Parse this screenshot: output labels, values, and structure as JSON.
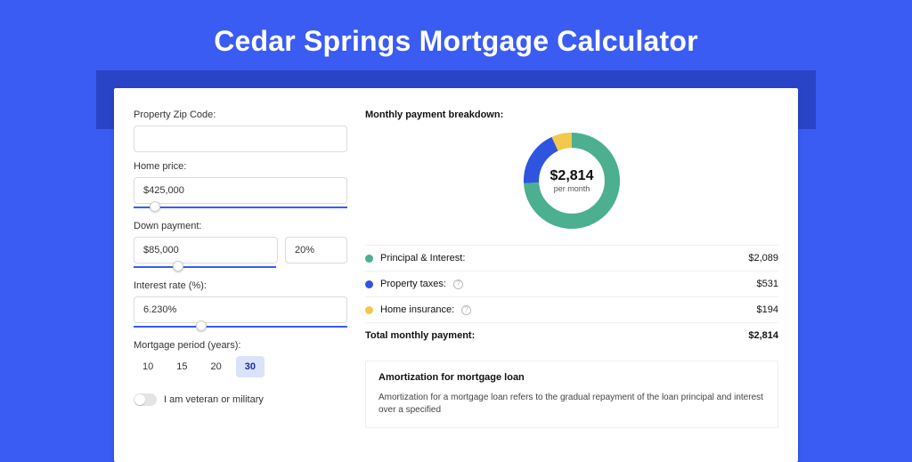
{
  "title": "Cedar Springs Mortgage Calculator",
  "form": {
    "zip_label": "Property Zip Code:",
    "zip_value": "",
    "home_price_label": "Home price:",
    "home_price_value": "$425,000",
    "down_payment_label": "Down payment:",
    "down_payment_amount": "$85,000",
    "down_payment_pct": "20%",
    "interest_label": "Interest rate (%):",
    "interest_value": "6.230%",
    "period_label": "Mortgage period (years):",
    "periods": [
      "10",
      "15",
      "20",
      "30"
    ],
    "period_selected": "30",
    "veteran_label": "I am veteran or military"
  },
  "breakdown": {
    "title": "Monthly payment breakdown:",
    "donut": {
      "amount": "$2,814",
      "sub": "per month",
      "segments": [
        {
          "label": "Principal & Interest:",
          "value": "$2,089",
          "color": "#4caf8f",
          "pct": 74
        },
        {
          "label": "Property taxes:",
          "value": "$531",
          "color": "#2f55e0",
          "pct": 19
        },
        {
          "label": "Home insurance:",
          "value": "$194",
          "color": "#f2c94c",
          "pct": 7
        }
      ]
    },
    "total_label": "Total monthly payment:",
    "total_value": "$2,814"
  },
  "amort": {
    "title": "Amortization for mortgage loan",
    "text": "Amortization for a mortgage loan refers to the gradual repayment of the loan principal and interest over a specified"
  },
  "chart_data": {
    "type": "pie",
    "title": "Monthly payment breakdown",
    "categories": [
      "Principal & Interest",
      "Property taxes",
      "Home insurance"
    ],
    "values": [
      2089,
      531,
      194
    ],
    "colors": [
      "#4caf8f",
      "#2f55e0",
      "#f2c94c"
    ],
    "total": 2814,
    "unit": "USD per month"
  }
}
